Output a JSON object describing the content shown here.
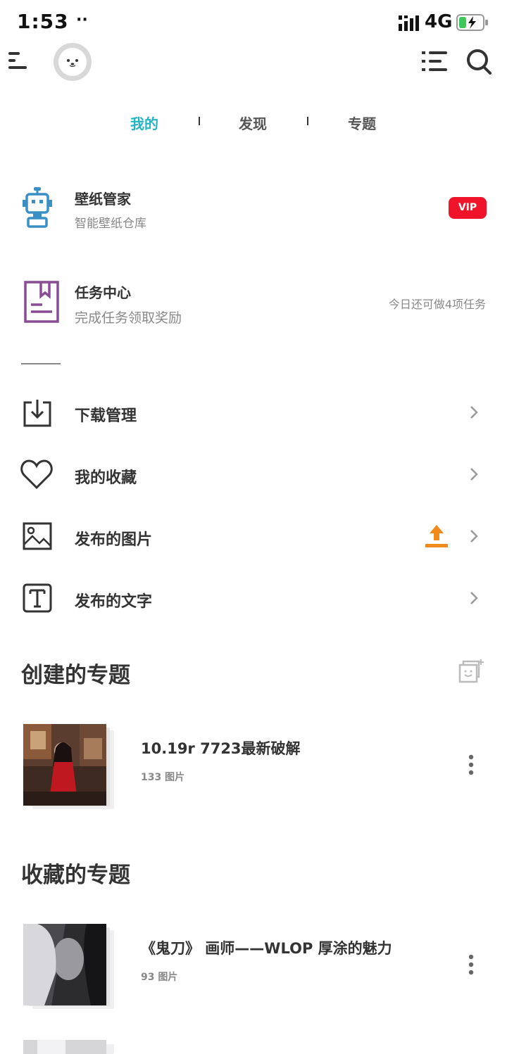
{
  "status_bar": {
    "time": "1:53",
    "dots": "··",
    "network": "4G"
  },
  "tabs": [
    {
      "label": "我的",
      "active": true
    },
    {
      "label": "发现",
      "active": false
    },
    {
      "label": "专题",
      "active": false
    }
  ],
  "wallpaper_manager": {
    "title": "壁纸管家",
    "subtitle": "智能壁纸仓库",
    "badge": "VIP"
  },
  "task_center": {
    "title": "任务中心",
    "subtitle": "完成任务领取奖励",
    "hint": "今日还可做4项任务"
  },
  "menu": [
    {
      "label": "下载管理",
      "icon": "download-icon"
    },
    {
      "label": "我的收藏",
      "icon": "heart-icon"
    },
    {
      "label": "发布的图片",
      "icon": "image-icon"
    },
    {
      "label": "发布的文字",
      "icon": "text-icon"
    }
  ],
  "created_topics": {
    "title": "创建的专题",
    "items": [
      {
        "title": "10.19r 7723最新破解",
        "count": "133 图片"
      }
    ]
  },
  "favorite_topics": {
    "title": "收藏的专题",
    "items": [
      {
        "title": "《鬼刀》  画师——WLOP 厚涂的魅力",
        "count": "93 图片"
      }
    ]
  },
  "colors": {
    "accent": "#25b4c4",
    "vip": "#f0142a",
    "upload": "#f08a1c",
    "robot": "#3a8fc4",
    "task": "#8a4b96"
  }
}
